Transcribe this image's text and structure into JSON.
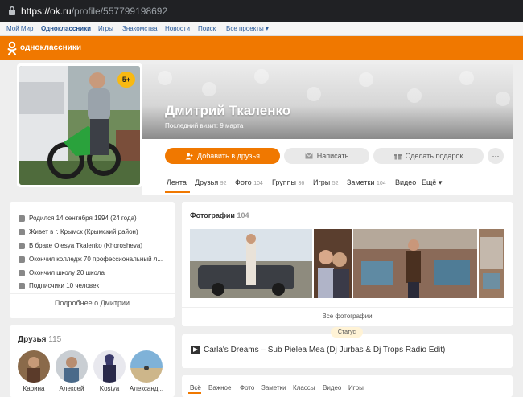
{
  "browser": {
    "url_base": "https://ok.ru",
    "url_path": "/profile/557799198692"
  },
  "portal_nav": [
    {
      "label": "Мой Мир",
      "active": false
    },
    {
      "label": "Одноклассники",
      "active": true
    },
    {
      "label": "Игры",
      "active": false
    },
    {
      "label": "Знакомства",
      "active": false
    },
    {
      "label": "Новости",
      "active": false
    },
    {
      "label": "Поиск",
      "active": false
    },
    {
      "label": "Все проекты ▾",
      "active": false
    }
  ],
  "header": {
    "brand": "одноклассники"
  },
  "profile": {
    "name": "Дмитрий Ткаленко",
    "last_visit": "Последний визит: 9 марта",
    "age_badge": "5+"
  },
  "actions": {
    "add_friend": "Добавить в друзья",
    "message": "Написать",
    "gift": "Сделать подарок",
    "more": "···"
  },
  "tabs": [
    {
      "label": "Лента",
      "count": ""
    },
    {
      "label": "Друзья",
      "count": "92"
    },
    {
      "label": "Фото",
      "count": "104"
    },
    {
      "label": "Группы",
      "count": "36"
    },
    {
      "label": "Игры",
      "count": "52"
    },
    {
      "label": "Заметки",
      "count": "104"
    },
    {
      "label": "Видео",
      "count": ""
    },
    {
      "label": "Ещё ▾",
      "count": ""
    }
  ],
  "info": {
    "items": [
      "Родился 14 сентября 1994 (24 года)",
      "Живет в г. Крымск (Крымский район)",
      "В браке Olesya Tkalenko (Khorosheva)",
      "Окончил колледж 70 профессиональный л...",
      "Окончил школу 20 школа",
      "Подписчики 10 человек"
    ],
    "more_link": "Подробнее о Дмитрии"
  },
  "friends": {
    "title": "Друзья",
    "count": "115",
    "items": [
      "Карина",
      "Алексей",
      "Kostya",
      "Александ..."
    ]
  },
  "photos": {
    "title": "Фотографии",
    "count": "104",
    "all_link": "Все фотографии"
  },
  "status": {
    "label": "Статус",
    "text": "Carla's Dreams – Sub Pielea Mea (Dj Jurbas & Dj Trops Radio Edit)"
  },
  "feed_filter": [
    "Всё",
    "Важное",
    "Фото",
    "Заметки",
    "Классы",
    "Видео",
    "Игры"
  ],
  "colors": {
    "brand_orange": "#f07800",
    "badge_yellow": "#f8b912",
    "link_blue": "#2a5b9b"
  }
}
